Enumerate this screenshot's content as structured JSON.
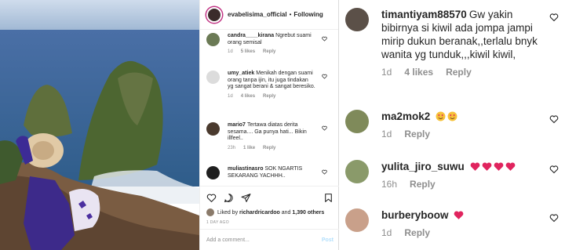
{
  "post": {
    "username": "evabelisima_official",
    "separator": "•",
    "follow_status": "Following"
  },
  "left_comments": [
    {
      "user": "candra____kirana",
      "text": "Ngrebut suami orang semisal",
      "time": "1d",
      "likes": "5 likes",
      "reply": "Reply"
    },
    {
      "user": "umy_atiek",
      "text": "Menikah dengan suami orang tanpa ijin, itu juga tindakan yg sangat berani & sangat beresiko.",
      "time": "1d",
      "likes": "4 likes",
      "reply": "Reply"
    },
    {
      "user": "mario7",
      "text": "Tertawa diatas derita sesama.... Ga punya hati... Bikin illfeel..",
      "time": "23h",
      "likes": "1 like",
      "reply": "Reply"
    },
    {
      "user": "muliastinasro",
      "text": "SOK NGARTIS SEKARANG YACHHH.."
    }
  ],
  "liked_by": {
    "prefix": "Liked by",
    "user": "richardricardoo",
    "middle": "and",
    "others": "1,390 others"
  },
  "post_date": "1 DAY AGO",
  "add_comment": {
    "placeholder": "Add a comment...",
    "post_label": "Post"
  },
  "right_comments": [
    {
      "user": "timantiyam88570",
      "text": "Gw yakin bibirnya si kiwil ada jompa jampi mirip dukun beranak,,terlalu bnyk wanita yg tunduk,,,kiwil kiwil,",
      "time": "1d",
      "likes": "4 likes",
      "reply": "Reply"
    },
    {
      "user": "ma2mok2",
      "emoji": [
        "heart-eyes-emoji",
        "heart-eyes-emoji"
      ],
      "time": "1d",
      "reply": "Reply"
    },
    {
      "user": "yulita_jiro_suwu",
      "emoji": [
        "red-heart-emoji",
        "red-heart-emoji",
        "red-heart-emoji",
        "red-heart-emoji"
      ],
      "time": "16h",
      "reply": "Reply"
    },
    {
      "user": "burberyboow",
      "emoji": [
        "red-heart-emoji"
      ],
      "time": "1d",
      "reply": "Reply"
    }
  ],
  "colors": {
    "heart": "#e0245e",
    "avatar_ring": "#c13584",
    "muted": "#8e8e8e",
    "post_disabled": "#b2dffc"
  }
}
